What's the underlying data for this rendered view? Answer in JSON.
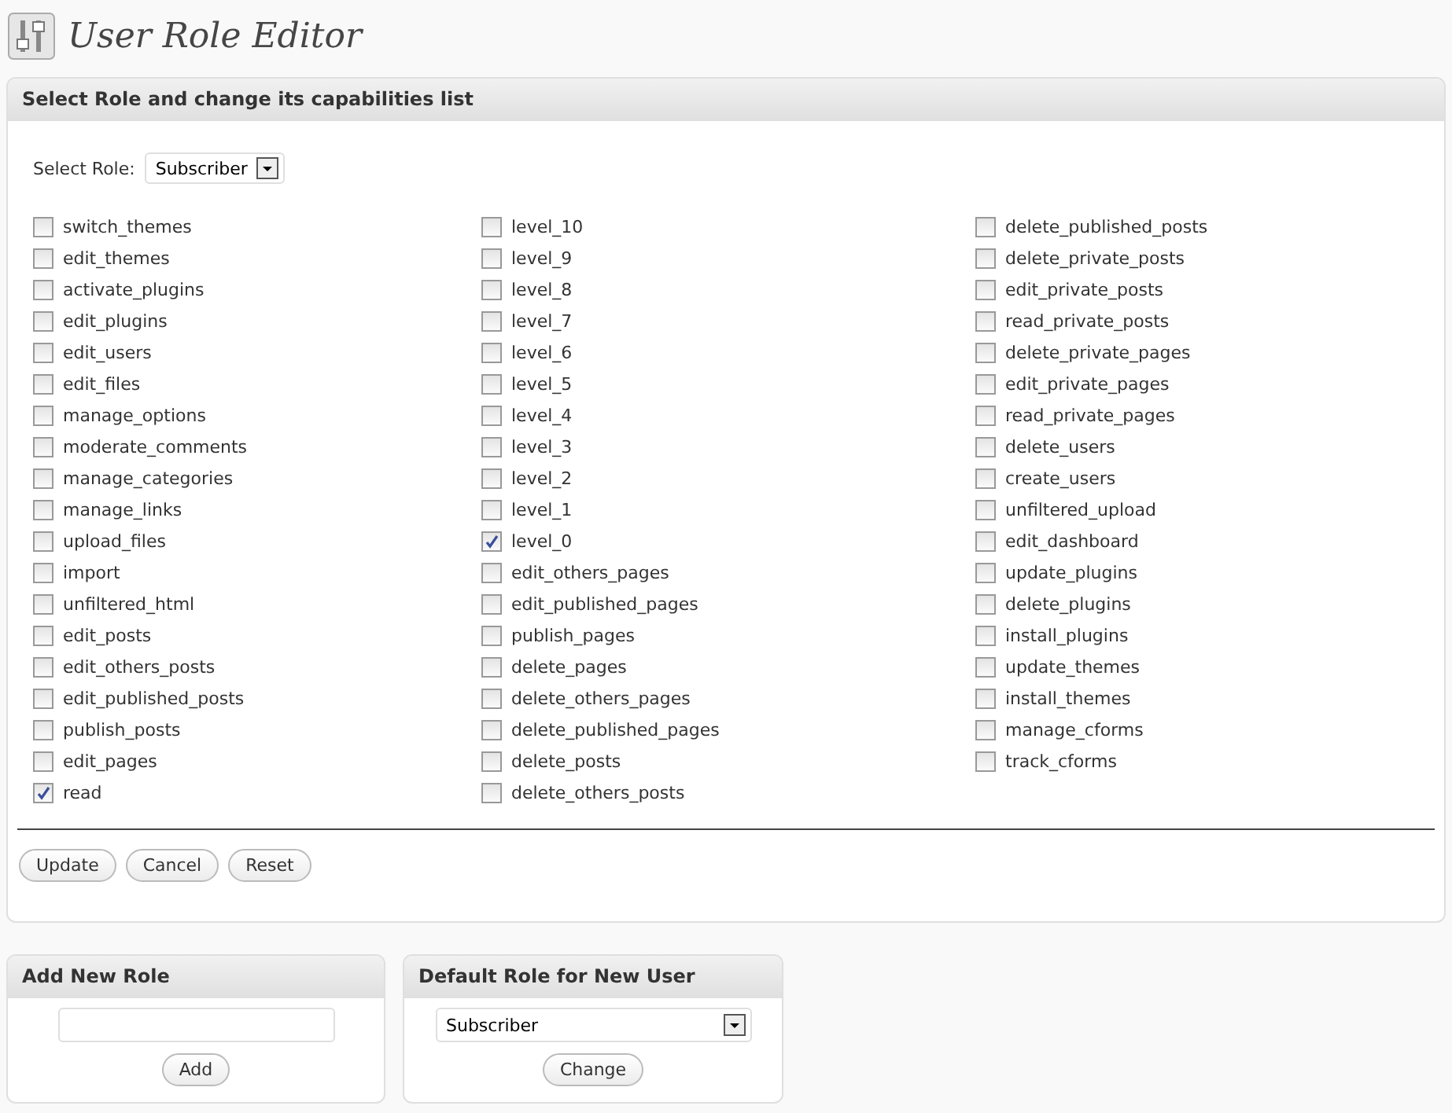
{
  "page_title": "User Role Editor",
  "main_panel": {
    "title": "Select Role and change its capabilities list",
    "role_label": "Select Role:",
    "role_value": "Subscriber",
    "capability_columns": [
      [
        {
          "label": "switch_themes",
          "checked": false
        },
        {
          "label": "edit_themes",
          "checked": false
        },
        {
          "label": "activate_plugins",
          "checked": false
        },
        {
          "label": "edit_plugins",
          "checked": false
        },
        {
          "label": "edit_users",
          "checked": false
        },
        {
          "label": "edit_files",
          "checked": false
        },
        {
          "label": "manage_options",
          "checked": false
        },
        {
          "label": "moderate_comments",
          "checked": false
        },
        {
          "label": "manage_categories",
          "checked": false
        },
        {
          "label": "manage_links",
          "checked": false
        },
        {
          "label": "upload_files",
          "checked": false
        },
        {
          "label": "import",
          "checked": false
        },
        {
          "label": "unfiltered_html",
          "checked": false
        },
        {
          "label": "edit_posts",
          "checked": false
        },
        {
          "label": "edit_others_posts",
          "checked": false
        },
        {
          "label": "edit_published_posts",
          "checked": false
        },
        {
          "label": "publish_posts",
          "checked": false
        },
        {
          "label": "edit_pages",
          "checked": false
        },
        {
          "label": "read",
          "checked": true
        }
      ],
      [
        {
          "label": "level_10",
          "checked": false
        },
        {
          "label": "level_9",
          "checked": false
        },
        {
          "label": "level_8",
          "checked": false
        },
        {
          "label": "level_7",
          "checked": false
        },
        {
          "label": "level_6",
          "checked": false
        },
        {
          "label": "level_5",
          "checked": false
        },
        {
          "label": "level_4",
          "checked": false
        },
        {
          "label": "level_3",
          "checked": false
        },
        {
          "label": "level_2",
          "checked": false
        },
        {
          "label": "level_1",
          "checked": false
        },
        {
          "label": "level_0",
          "checked": true
        },
        {
          "label": "edit_others_pages",
          "checked": false
        },
        {
          "label": "edit_published_pages",
          "checked": false
        },
        {
          "label": "publish_pages",
          "checked": false
        },
        {
          "label": "delete_pages",
          "checked": false
        },
        {
          "label": "delete_others_pages",
          "checked": false
        },
        {
          "label": "delete_published_pages",
          "checked": false
        },
        {
          "label": "delete_posts",
          "checked": false
        },
        {
          "label": "delete_others_posts",
          "checked": false
        }
      ],
      [
        {
          "label": "delete_published_posts",
          "checked": false
        },
        {
          "label": "delete_private_posts",
          "checked": false
        },
        {
          "label": "edit_private_posts",
          "checked": false
        },
        {
          "label": "read_private_posts",
          "checked": false
        },
        {
          "label": "delete_private_pages",
          "checked": false
        },
        {
          "label": "edit_private_pages",
          "checked": false
        },
        {
          "label": "read_private_pages",
          "checked": false
        },
        {
          "label": "delete_users",
          "checked": false
        },
        {
          "label": "create_users",
          "checked": false
        },
        {
          "label": "unfiltered_upload",
          "checked": false
        },
        {
          "label": "edit_dashboard",
          "checked": false
        },
        {
          "label": "update_plugins",
          "checked": false
        },
        {
          "label": "delete_plugins",
          "checked": false
        },
        {
          "label": "install_plugins",
          "checked": false
        },
        {
          "label": "update_themes",
          "checked": false
        },
        {
          "label": "install_themes",
          "checked": false
        },
        {
          "label": "manage_cforms",
          "checked": false
        },
        {
          "label": "track_cforms",
          "checked": false
        }
      ]
    ],
    "buttons": [
      "Update",
      "Cancel",
      "Reset"
    ]
  },
  "add_role_panel": {
    "title": "Add New Role",
    "button": "Add"
  },
  "default_role_panel": {
    "title": "Default Role for New User",
    "role_value": "Subscriber",
    "button": "Change"
  }
}
